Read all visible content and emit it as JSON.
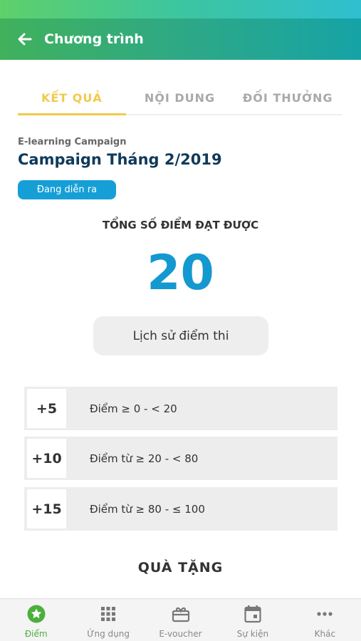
{
  "app_bar": {
    "title": "Chương trình"
  },
  "tabs": [
    {
      "label": "KẾT QUẢ",
      "active": true
    },
    {
      "label": "NỘI DUNG",
      "active": false
    },
    {
      "label": "ĐỐI THƯỞNG",
      "active": false
    }
  ],
  "campaign": {
    "type": "E-learning Campaign",
    "title": "Campaign Tháng 2/2019",
    "status": "Đang diễn ra"
  },
  "score": {
    "label": "TỔNG SỐ ĐIỂM ĐẠT ĐƯỢC",
    "value": "20"
  },
  "history_button": "Lịch sử điểm thi",
  "rules": [
    {
      "points": "+5",
      "desc": "Điểm ≥ 0 - < 20"
    },
    {
      "points": "+10",
      "desc": "Điểm từ  ≥ 20 - < 80"
    },
    {
      "points": "+15",
      "desc": "Điểm từ  ≥ 80 - ≤ 100"
    }
  ],
  "gift_title": "QUÀ TẶNG",
  "bottom_nav": [
    {
      "label": "Điểm",
      "icon": "star-icon",
      "active": true
    },
    {
      "label": "Ứng dụng",
      "icon": "apps-grid-icon",
      "active": false
    },
    {
      "label": "E-voucher",
      "icon": "voucher-icon",
      "active": false
    },
    {
      "label": "Sự kiện",
      "icon": "calendar-icon",
      "active": false
    },
    {
      "label": "Khác",
      "icon": "more-icon",
      "active": false
    }
  ],
  "colors": {
    "accent_tab": "#f2c94c",
    "score_blue": "#1399d0",
    "badge_blue": "#169fd6",
    "nav_active": "#4caf3c",
    "title_navy": "#0f3a5b"
  }
}
